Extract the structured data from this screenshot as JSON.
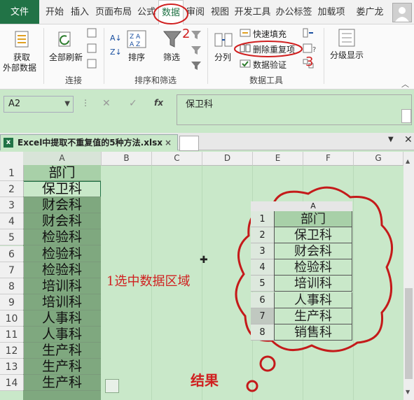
{
  "menu": {
    "file": "文件",
    "tabs": [
      "开始",
      "插入",
      "页面布局",
      "公式",
      "数据",
      "审阅",
      "视图",
      "开发工具",
      "办公标签",
      "加载项"
    ],
    "user": "娄广龙"
  },
  "ribbon": {
    "get_external_line1": "获取",
    "get_external_line2": "外部数据",
    "refresh_all": "全部刷新",
    "group_connections": "连接",
    "sort": "排序",
    "filter": "筛选",
    "group_sort_filter": "排序和筛选",
    "split": "分列",
    "flash_fill": "快速填充",
    "remove_duplicates": "删除重复项",
    "data_validation": "数据验证",
    "group_data_tools": "数据工具",
    "outline": "分级显示",
    "marker_2": "2",
    "marker_3": "3"
  },
  "formula_bar": {
    "name_box": "A2",
    "fx": "fx",
    "content": "保卫科"
  },
  "file_tab": {
    "title": "Excel中提取不重复值的5种方法.xlsx",
    "close": "×"
  },
  "sheet": {
    "columns": [
      "A",
      "B",
      "C",
      "D",
      "E",
      "F",
      "G"
    ],
    "rows": [
      "1",
      "2",
      "3",
      "4",
      "5",
      "6",
      "7",
      "8",
      "9",
      "10",
      "11",
      "12",
      "13",
      "14"
    ],
    "colA": [
      "部门",
      "保卫科",
      "财会科",
      "财会科",
      "检验科",
      "检验科",
      "检验科",
      "培训科",
      "培训科",
      "人事科",
      "人事科",
      "生产科",
      "生产科",
      "生产科"
    ],
    "annotation": "1选中数据区域",
    "result_label": "结果"
  },
  "result_table": {
    "col_header": "A",
    "row_numbers": [
      "1",
      "2",
      "3",
      "4",
      "5",
      "6",
      "7",
      "8"
    ],
    "values": [
      "部门",
      "保卫科",
      "财会科",
      "检验科",
      "培训科",
      "人事科",
      "生产科",
      "销售科"
    ]
  },
  "colors": {
    "sheet_bg": "#c9e8c9",
    "excel_green": "#217346",
    "annotation_red": "#d02020"
  }
}
